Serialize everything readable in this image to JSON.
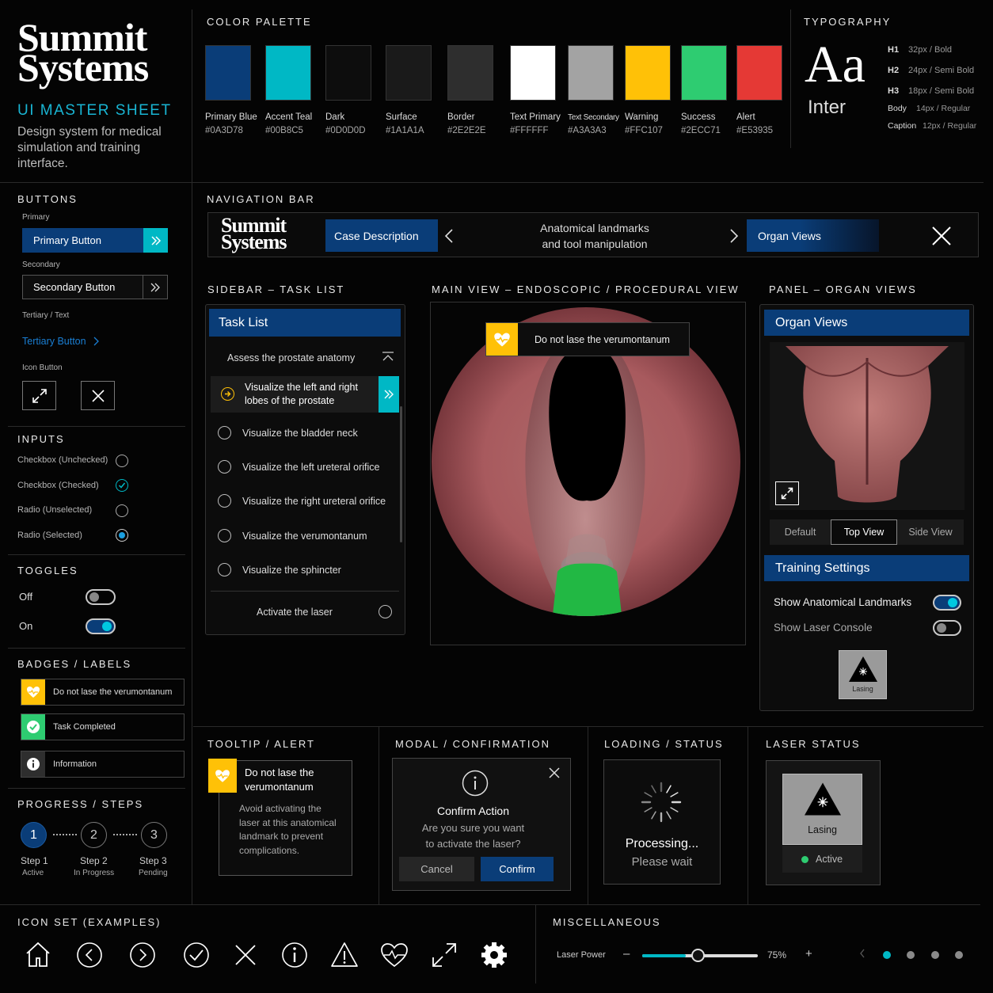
{
  "brand": {
    "logo_line1": "Summit",
    "logo_line2": "Systems",
    "sheet_title": "UI MASTER SHEET",
    "description": "Design system for medical simulation and training interface."
  },
  "sections": {
    "color_palette": "COLOR PALETTE",
    "typography": "TYPOGRAPHY",
    "buttons": "BUTTONS",
    "navigation_bar": "NAVIGATION BAR",
    "inputs": "INPUTS",
    "toggles": "TOGGLES",
    "badges_labels": "BADGES / LABELS",
    "progress_steps": "PROGRESS / STEPS",
    "sidebar_task_list": "SIDEBAR – TASK LIST",
    "main_view": "MAIN VIEW – ENDOSCOPIC / PROCEDURAL VIEW",
    "panel_organ_views": "PANEL – ORGAN VIEWS",
    "tooltip_alert": "TOOLTIP / ALERT",
    "modal_confirmation": "MODAL / CONFIRMATION",
    "loading_status": "LOADING / STATUS",
    "laser_status": "LASER STATUS",
    "icon_set": "ICON SET (EXAMPLES)",
    "miscellaneous": "MISCELLANEOUS"
  },
  "colors": [
    {
      "name": "Primary Blue",
      "hex": "#0A3D78"
    },
    {
      "name": "Accent Teal",
      "hex": "#00B8C5"
    },
    {
      "name": "Dark",
      "hex": "#0D0D0D"
    },
    {
      "name": "Surface",
      "hex": "#1A1A1A"
    },
    {
      "name": "Border",
      "hex": "#2E2E2E"
    },
    {
      "name": "Text Primary",
      "hex": "#FFFFFF"
    },
    {
      "name": "Text Secondary",
      "hex": "#A3A3A3"
    },
    {
      "name": "Warning",
      "hex": "#FFC107"
    },
    {
      "name": "Success",
      "hex": "#2ECC71"
    },
    {
      "name": "Alert",
      "hex": "#E53935"
    }
  ],
  "typography": {
    "sample": "Aa",
    "font": "Inter",
    "styles": [
      {
        "tag": "H1",
        "spec": "32px / Bold"
      },
      {
        "tag": "H2",
        "spec": "24px / Semi Bold"
      },
      {
        "tag": "H3",
        "spec": "18px / Semi Bold"
      },
      {
        "tag": "Body",
        "spec": "14px / Regular"
      },
      {
        "tag": "Caption",
        "spec": "12px / Regular"
      }
    ]
  },
  "buttons": {
    "primary_label": "Primary",
    "primary_button": "Primary Button",
    "secondary_label": "Secondary",
    "secondary_button": "Secondary Button",
    "tertiary_label": "Tertiary / Text",
    "tertiary_button": "Tertiary Button",
    "icon_label": "Icon Button"
  },
  "inputs": [
    "Checkbox (Unchecked)",
    "Checkbox (Checked)",
    "Radio (Unselected)",
    "Radio (Selected)"
  ],
  "toggles": {
    "off": "Off",
    "on": "On"
  },
  "badges": [
    "Do not lase the verumontanum",
    "Task Completed",
    "Information"
  ],
  "steps": [
    {
      "num": "1",
      "title": "Step 1",
      "status": "Active"
    },
    {
      "num": "2",
      "title": "Step 2",
      "status": "In Progress"
    },
    {
      "num": "3",
      "title": "Step 3",
      "status": "Pending"
    }
  ],
  "navbar": {
    "case_description": "Case Description",
    "center_line1": "Anatomical landmarks",
    "center_line2": "and tool manipulation",
    "organ_views": "Organ Views"
  },
  "task_list": {
    "title": "Task List",
    "header_task": "Assess the prostate anatomy",
    "active_task_line1": "Visualize the left and right",
    "active_task_line2": "lobes of the prostate",
    "tasks": [
      "Visualize the bladder neck",
      "Visualize the left ureteral orifice",
      "Visualize the right ureteral orifice",
      "Visualize the verumontanum",
      "Visualize the sphincter"
    ],
    "final_task": "Activate the laser"
  },
  "main_view": {
    "warning": "Do not lase the verumontanum"
  },
  "organ_panel": {
    "title": "Organ Views",
    "tabs": [
      "Default",
      "Top View",
      "Side View"
    ],
    "active_tab": "Top View",
    "settings_title": "Training Settings",
    "settings": [
      {
        "label": "Show Anatomical Landmarks",
        "on": true
      },
      {
        "label": "Show Laser Console",
        "on": false
      }
    ],
    "lasing_label": "Lasing"
  },
  "tooltip": {
    "title_line1": "Do not lase the",
    "title_line2": "verumontanum",
    "body": "Avoid activating the laser at this anatomical landmark to prevent complications."
  },
  "modal": {
    "title": "Confirm Action",
    "body_line1": "Are you sure you want",
    "body_line2": "to activate the laser?",
    "cancel": "Cancel",
    "confirm": "Confirm"
  },
  "loading": {
    "line1": "Processing...",
    "line2": "Please wait"
  },
  "laser_status": {
    "label": "Lasing",
    "status": "Active"
  },
  "icons": [
    "home-icon",
    "chevron-left-circle-icon",
    "chevron-right-circle-icon",
    "check-circle-icon",
    "close-icon",
    "info-icon",
    "warning-triangle-icon",
    "heart-pulse-icon",
    "expand-icon",
    "gear-icon"
  ],
  "misc": {
    "slider_label": "Laser Power",
    "minus": "–",
    "plus": "+",
    "slider_value": 0.75,
    "slider_text": "75%",
    "carousel_active": 1,
    "carousel_count": 4
  }
}
